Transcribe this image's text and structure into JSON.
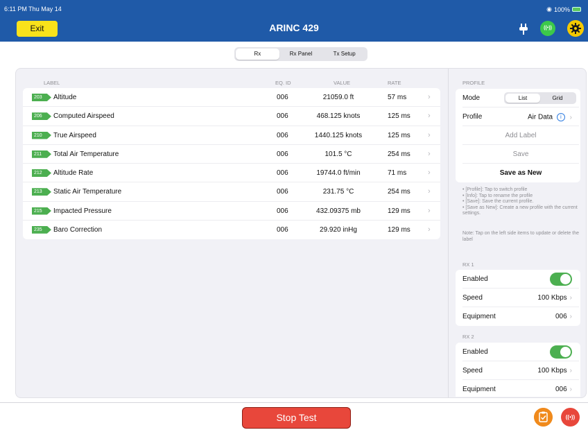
{
  "status_bar": {
    "time": "6:11 PM  Thu May 14",
    "battery": "100%"
  },
  "header": {
    "exit_label": "Exit",
    "title": "ARINC 429",
    "signal_icon_text": "((•))"
  },
  "tabs": [
    {
      "label": "Rx",
      "active": true
    },
    {
      "label": "Rx Panel",
      "active": false
    },
    {
      "label": "Tx Setup",
      "active": false
    }
  ],
  "table": {
    "columns": {
      "label": "LABEL",
      "eq_id": "EQ. ID",
      "value": "VALUE",
      "rate": "RATE"
    },
    "rows": [
      {
        "tag": "203",
        "label": "Altitude",
        "eq_id": "006",
        "value": "21059.0 ft",
        "rate": "57 ms"
      },
      {
        "tag": "206",
        "label": "Computed Airspeed",
        "eq_id": "006",
        "value": "468.125 knots",
        "rate": "125 ms"
      },
      {
        "tag": "210",
        "label": "True Airspeed",
        "eq_id": "006",
        "value": "1440.125 knots",
        "rate": "125 ms"
      },
      {
        "tag": "211",
        "label": "Total Air Temperature",
        "eq_id": "006",
        "value": "101.5 °C",
        "rate": "254 ms"
      },
      {
        "tag": "212",
        "label": "Altitude Rate",
        "eq_id": "006",
        "value": "19744.0 ft/min",
        "rate": "71 ms"
      },
      {
        "tag": "213",
        "label": "Static Air Temperature",
        "eq_id": "006",
        "value": "231.75 °C",
        "rate": "254 ms"
      },
      {
        "tag": "215",
        "label": "Impacted Pressure",
        "eq_id": "006",
        "value": "432.09375 mb",
        "rate": "129 ms"
      },
      {
        "tag": "235",
        "label": "Baro Correction",
        "eq_id": "006",
        "value": "29.920 inHg",
        "rate": "129 ms"
      }
    ]
  },
  "profile": {
    "section_title": "PROFILE",
    "mode_label": "Mode",
    "mode_options": [
      "List",
      "Grid"
    ],
    "mode_selected": "List",
    "profile_label": "Profile",
    "profile_value": "Air Data",
    "add_label": "Add Label",
    "save": "Save",
    "save_as_new": "Save as New",
    "help_lines": [
      "• [Profile]: Tap to switch profile",
      "• [Info]: Tap to rename the profile",
      "• [Save]: Save the current profile.",
      "• [Save as New]: Create a new profile with the current settings."
    ],
    "note": "Note: Tap on the left side items to update or delete the label"
  },
  "rx1": {
    "title": "RX 1",
    "enabled_label": "Enabled",
    "enabled": true,
    "speed_label": "Speed",
    "speed": "100 Kbps",
    "equipment_label": "Equipment",
    "equipment": "006"
  },
  "rx2": {
    "title": "RX 2",
    "enabled_label": "Enabled",
    "enabled": true,
    "speed_label": "Speed",
    "speed": "100 Kbps",
    "equipment_label": "Equipment",
    "equipment": "006"
  },
  "footer": {
    "stop_label": "Stop Test",
    "signal_icon_text": "((•))"
  },
  "colors": {
    "header": "#1f5aa8",
    "exit": "#f9e21b",
    "tag": "#4caf50",
    "stop": "#e8473b",
    "report": "#f08a1c"
  }
}
